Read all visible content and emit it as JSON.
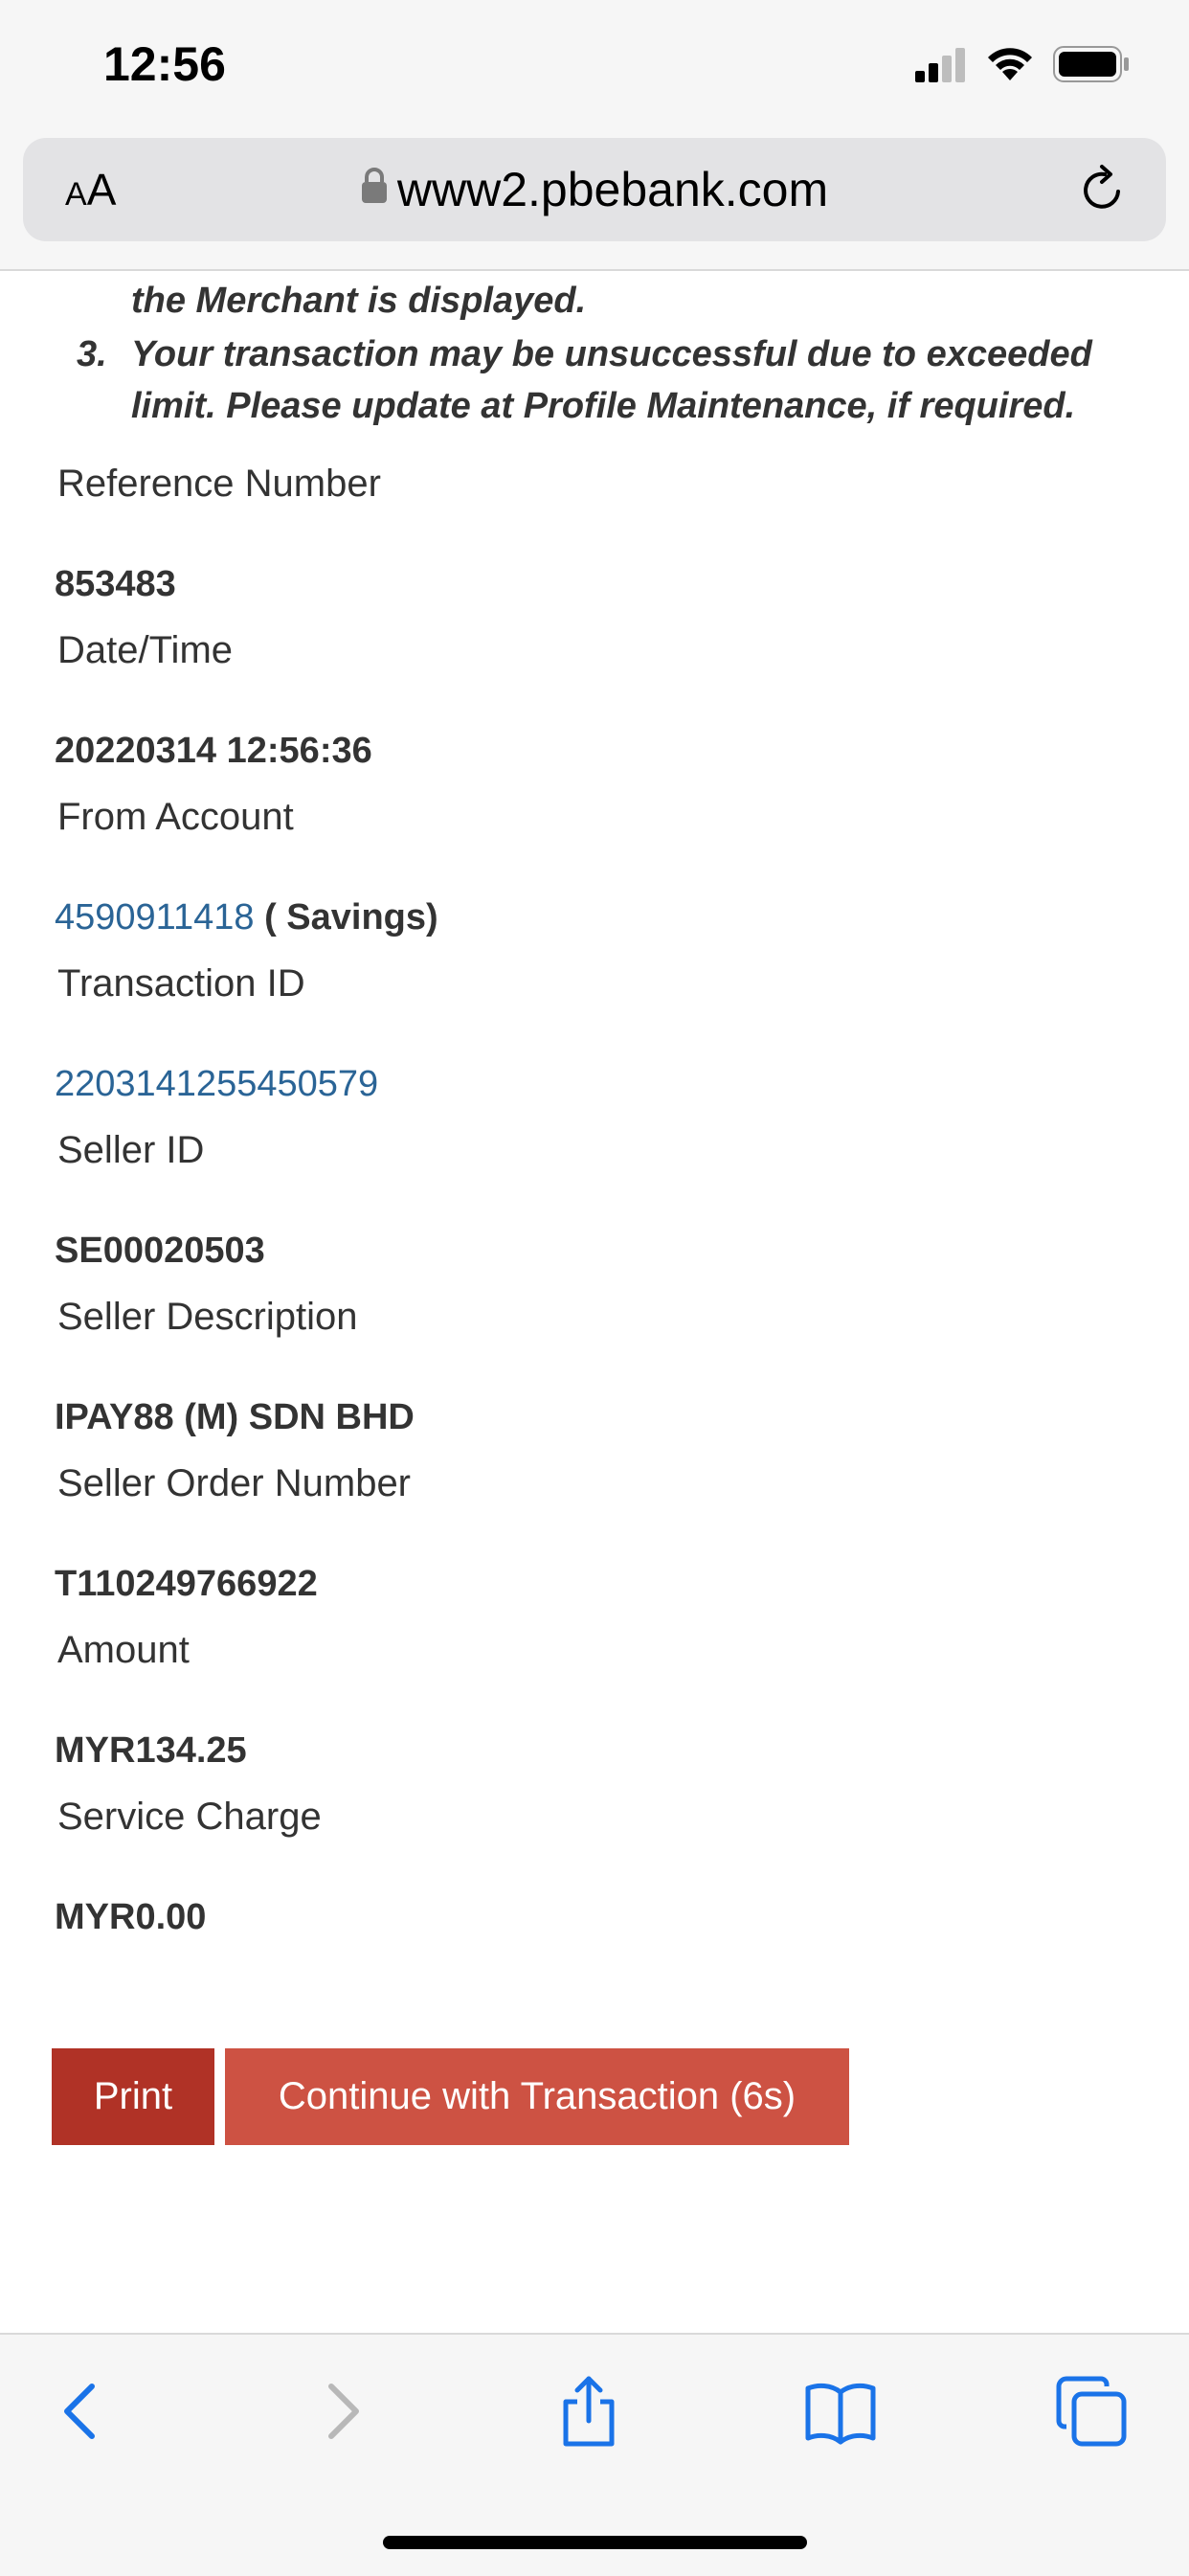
{
  "status_bar": {
    "time": "12:56"
  },
  "browser": {
    "aa_label_small": "A",
    "aa_label_large": "A",
    "url": "www2.pbebank.com"
  },
  "notes": {
    "line_1": "the Merchant is displayed.",
    "item_3_number": "3.",
    "item_3_line_1": "Your transaction may be unsuccessful due to exceeded",
    "item_3_line_2": "limit. Please update at Profile Maintenance, if required."
  },
  "fields": [
    {
      "label": "Reference Number",
      "value": "853483"
    },
    {
      "label": "Date/Time",
      "value": "20220314 12:56:36"
    },
    {
      "label": "From Account",
      "value": "4590911418",
      "suffix": " ( Savings)"
    },
    {
      "label": "Transaction ID",
      "value": "2203141255450579"
    },
    {
      "label": "Seller ID",
      "value": "SE00020503"
    },
    {
      "label": "Seller Description",
      "value": "IPAY88 (M) SDN BHD"
    },
    {
      "label": "Seller Order Number",
      "value": "T110249766922"
    },
    {
      "label": "Amount",
      "value": "MYR134.25"
    },
    {
      "label": "Service Charge",
      "value": "MYR0.00"
    }
  ],
  "buttons": {
    "print": "Print",
    "continue": "Continue with Transaction (6s)"
  },
  "colors": {
    "link": "#2a6496",
    "print_button": "#b03226",
    "continue_button": "#cd5243",
    "ios_blue": "#1a73e8"
  },
  "icons": {
    "back": "chevron-left",
    "forward": "chevron-right",
    "share": "share",
    "bookmarks": "book",
    "tabs": "tabs"
  }
}
